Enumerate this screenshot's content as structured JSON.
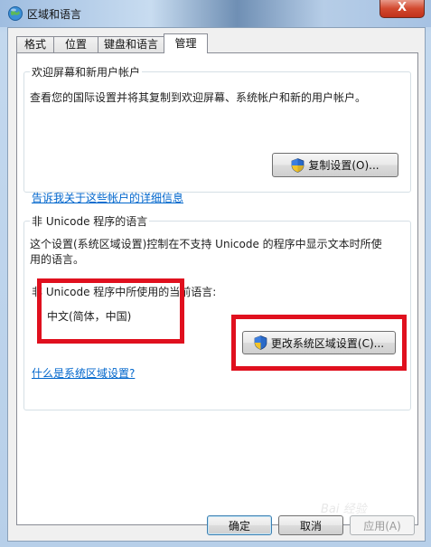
{
  "window": {
    "title": "区域和语言",
    "close_glyph": "X"
  },
  "tabs": [
    {
      "label": "格式"
    },
    {
      "label": "位置"
    },
    {
      "label": "键盘和语言"
    },
    {
      "label": "管理",
      "active": true
    }
  ],
  "welcome_group": {
    "legend": "欢迎屏幕和新用户帐户",
    "description": "查看您的国际设置并将其复制到欢迎屏幕、系统帐户和新的用户帐户。",
    "copy_button": "复制设置(O)...",
    "details_link": "告诉我关于这些帐户的详细信息"
  },
  "non_unicode_group": {
    "legend": "非 Unicode 程序的语言",
    "description_line1": "这个设置(系统区域设置)控制在不支持 Unicode 的程序中显示文本时所使",
    "description_line2": "用的语言。",
    "current_label": "非 Unicode 程序中所使用的当前语言:",
    "current_value": "中文(简体，中国)",
    "change_button": "更改系统区域设置(C)...",
    "what_link": "什么是系统区域设置?"
  },
  "footer": {
    "ok": "确定",
    "cancel": "取消",
    "apply": "应用(A)",
    "watermark": "Bai 经验"
  },
  "colors": {
    "highlight_box": "#e0101e",
    "link": "#0066cc"
  }
}
